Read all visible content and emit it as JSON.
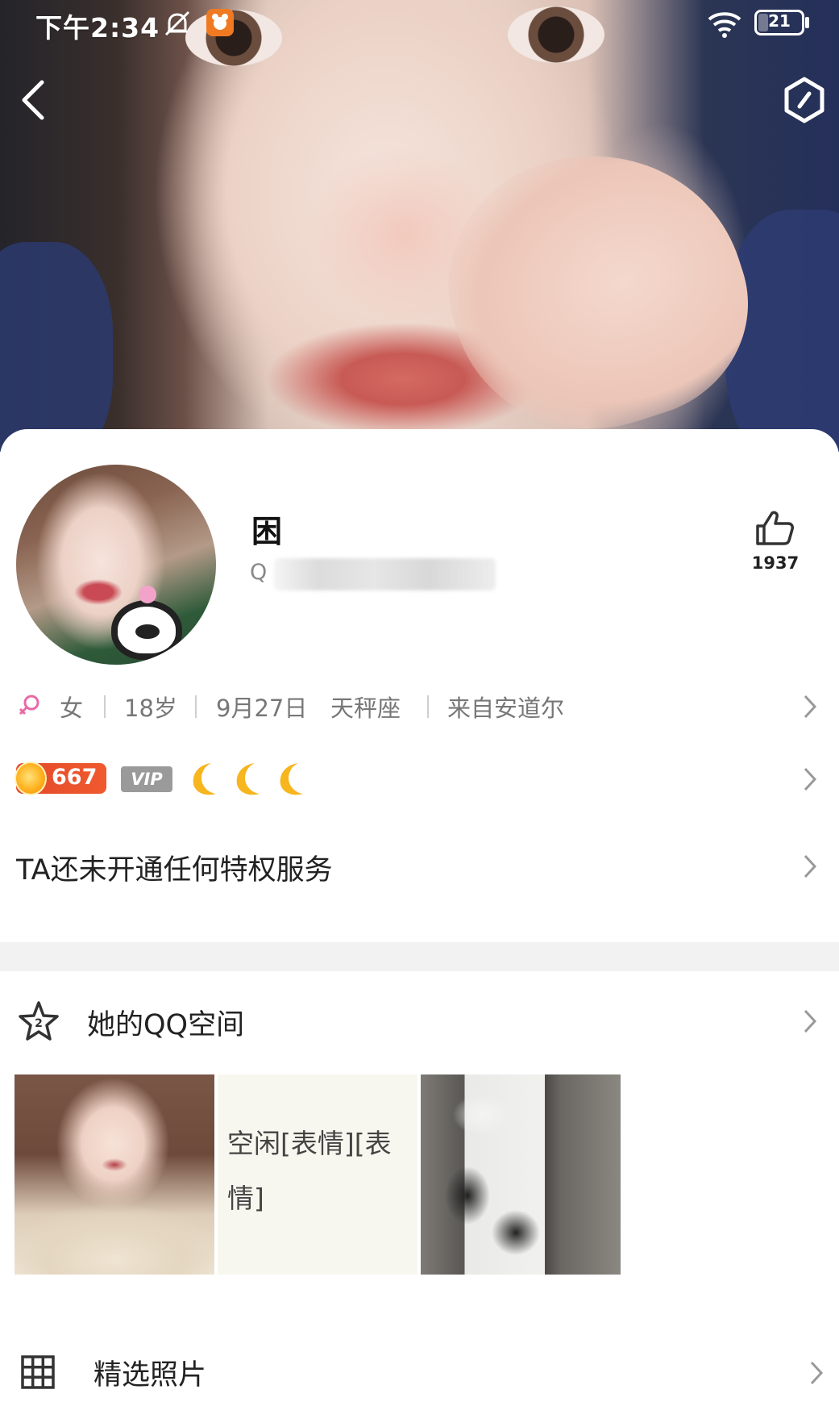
{
  "status_bar": {
    "time": "下午2:34",
    "battery_level": "21",
    "icons": [
      "mute-bell-icon",
      "app-notification-icon",
      "wifi-icon",
      "battery-icon"
    ]
  },
  "nav": {
    "back_icon": "chevron-left-icon",
    "settings_icon": "hexagon-settings-icon"
  },
  "profile": {
    "nickname": "困",
    "qq_prefix": "Q",
    "like_count": "1937",
    "like_icon": "thumbs-up-icon"
  },
  "info": {
    "gender_icon": "female-icon",
    "gender": "女",
    "age": "18岁",
    "birthday": "9月27日",
    "zodiac": "天秤座",
    "location": "来自安道尔"
  },
  "level": {
    "level_number": "667",
    "vip_label": "VIP",
    "moon_count": 3,
    "colors": {
      "level_badge": "#e34a2a",
      "moon": "#f7b51e",
      "vip_badge": "#9a9a9a"
    }
  },
  "privilege": {
    "text": "TA还未开通任何特权服务"
  },
  "qzone": {
    "title": "她的QQ空间",
    "icon": "star-2-icon",
    "thumb_text": "空闲[表情][表情]"
  },
  "photos": {
    "title": "精选照片",
    "icon": "grid-icon"
  }
}
